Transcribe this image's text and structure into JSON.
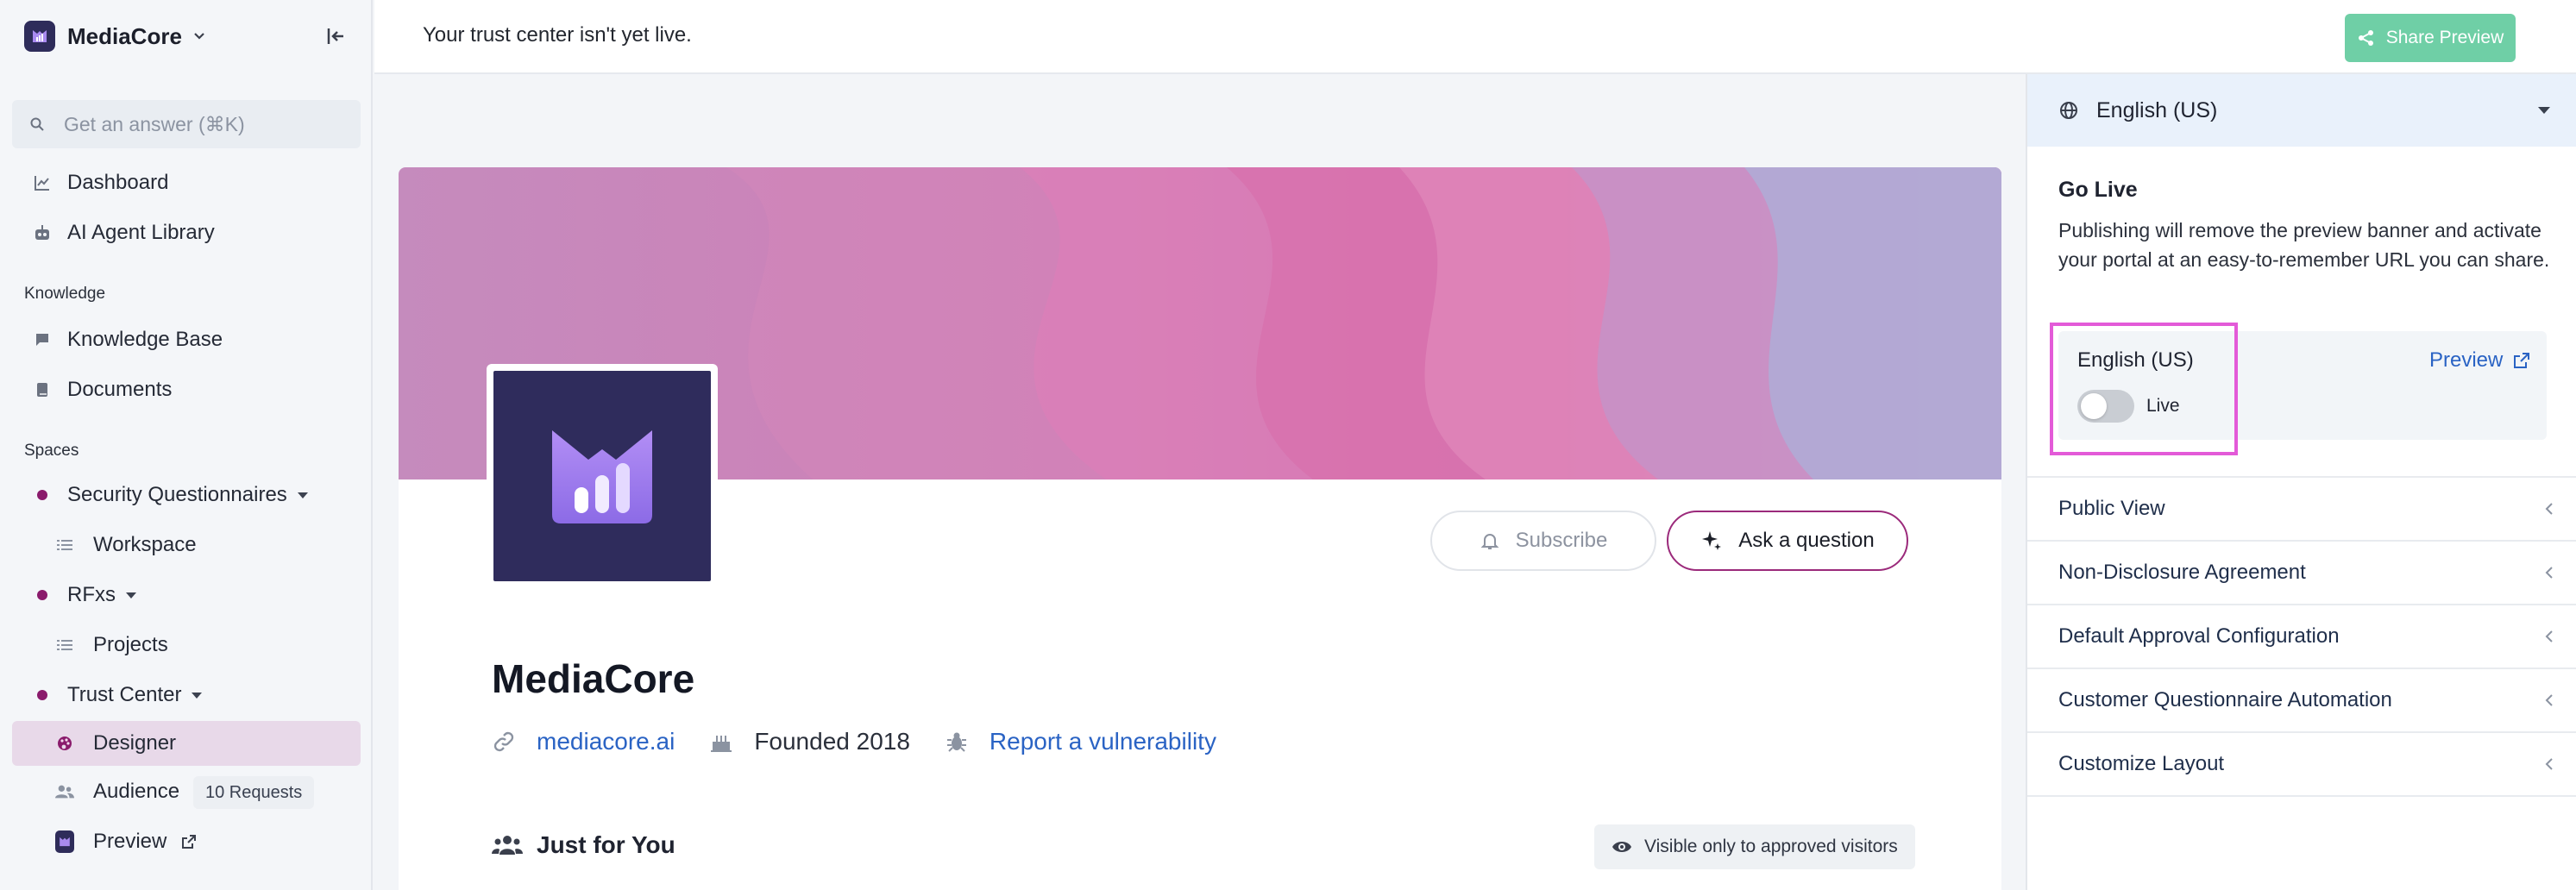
{
  "sidebar": {
    "brand_name": "MediaCore",
    "search_placeholder": "Get an answer (⌘K)",
    "items": {
      "dashboard": "Dashboard",
      "ai_agent_library": "AI Agent Library",
      "knowledge_base": "Knowledge Base",
      "documents": "Documents",
      "security_questionnaires": "Security Questionnaires",
      "workspace": "Workspace",
      "rfxs": "RFxs",
      "projects": "Projects",
      "trust_center": "Trust Center",
      "designer": "Designer",
      "audience": "Audience",
      "audience_badge": "10 Requests",
      "preview": "Preview"
    },
    "sections": {
      "knowledge": "Knowledge",
      "spaces": "Spaces"
    }
  },
  "topbar": {
    "message": "Your trust center isn't yet live.",
    "share_label": "Share Preview"
  },
  "main": {
    "subscribe_label": "Subscribe",
    "ask_label": "Ask a question",
    "company_name": "MediaCore",
    "website": "mediacore.ai",
    "founded": "Founded 2018",
    "report_link": "Report a vulnerability",
    "section_title": "Just for You",
    "visibility_note": "Visible only to approved visitors"
  },
  "panel": {
    "language": "English (US)",
    "go_live_title": "Go Live",
    "go_live_desc": "Publishing will remove the preview banner and activate your portal at an easy-to-remember URL you can share.",
    "card_language": "English (US)",
    "toggle_label": "Live",
    "toggle_on": false,
    "preview_label": "Preview",
    "sections": [
      "Public View",
      "Non-Disclosure Agreement",
      "Default Approval Configuration",
      "Customer Questionnaire Automation",
      "Customize Layout"
    ]
  },
  "colors": {
    "accent": "#8a1b6c",
    "share_button": "#6fcfa6",
    "link": "#2a63c4",
    "highlight": "#e35ad8"
  }
}
